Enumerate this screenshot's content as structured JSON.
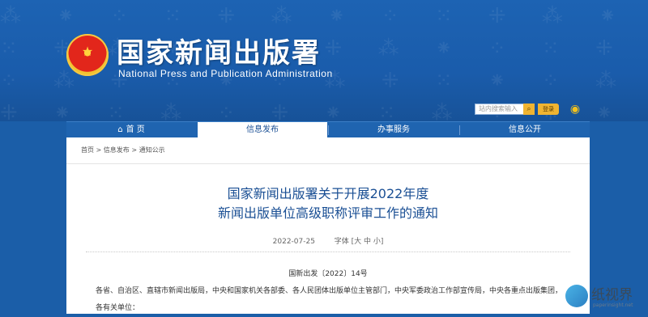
{
  "header": {
    "title_cn": "国家新闻出版署",
    "title_en": "National Press and Publication Administration",
    "search_placeholder": "站内搜索输入",
    "login_label": "登录"
  },
  "nav": {
    "items": [
      {
        "label": "首 页"
      },
      {
        "label": "信息发布"
      },
      {
        "label": "办事服务"
      },
      {
        "label": "信息公开"
      }
    ]
  },
  "breadcrumb": {
    "items": [
      "首页",
      "信息发布",
      "通知公示"
    ],
    "separator": ">"
  },
  "article": {
    "title_line1": "国家新闻出版署关于开展2022年度",
    "title_line2": "新闻出版单位高级职称评审工作的通知",
    "date": "2022-07-25",
    "font_label": "字体",
    "font_sizes": "[大 中 小]",
    "doc_number": "国新出发〔2022〕14号",
    "body": "各省、自治区、直辖市新闻出版局，中央和国家机关各部委、各人民团体出版单位主管部门，中央军委政治工作部宣传局，中央各重点出版集团，各有关单位："
  },
  "watermark": {
    "brand_cn": "纸视界",
    "brand_url": "paperinsight.net"
  },
  "colors": {
    "banner": "#1b5ea8",
    "nav_active_text": "#1a4f94",
    "headline": "#1a4f94",
    "accent_gold": "#f0b431"
  },
  "icons": [
    "national-emblem-icon",
    "home-icon",
    "search-icon",
    "weibo-icon"
  ]
}
